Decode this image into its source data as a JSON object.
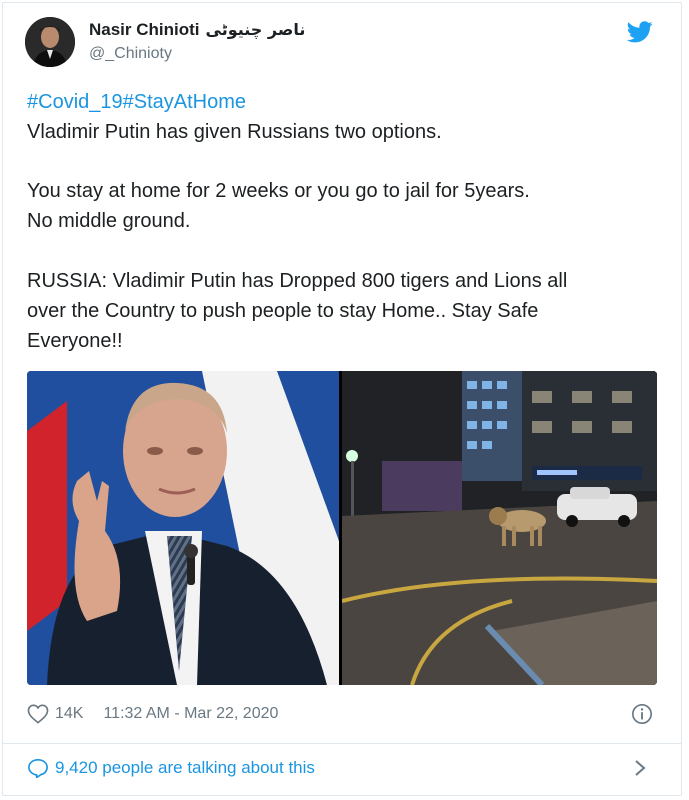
{
  "author": {
    "name": "Nasir Chinioti",
    "name_urdu": "ناصر چنیوٹی",
    "handle": "@_Chinioty"
  },
  "tweet": {
    "hashtags": [
      "#Covid_19",
      "#StayAtHome"
    ],
    "lines": [
      "Vladimir Putin has given Russians two options.",
      "You stay at home for 2 weeks or you go to jail for 5years.",
      "No middle ground.",
      "RUSSIA: Vladimir Putin has Dropped 800 tigers and Lions all",
      "over the Country to push people to stay Home.. Stay Safe",
      "Everyone!!"
    ]
  },
  "footer": {
    "likes": "14K",
    "timestamp": "11:32 AM - Mar 22, 2020"
  },
  "conversation": {
    "label": "9,420 people are talking about this"
  },
  "colors": {
    "link": "#1b95e0",
    "muted": "#697882",
    "text": "#1c2022",
    "border": "#e1e8ed"
  },
  "icons": [
    "twitter-bird-icon",
    "heart-icon",
    "info-icon",
    "comment-bubble-icon",
    "chevron-right-icon"
  ]
}
